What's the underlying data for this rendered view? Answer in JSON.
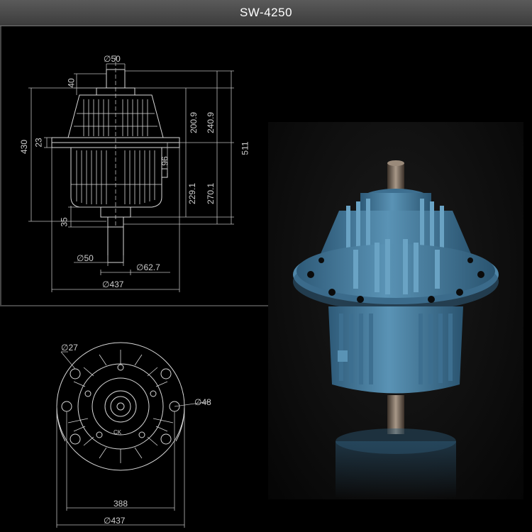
{
  "header": {
    "model": "SW-4250"
  },
  "side_view": {
    "top_shaft_dia": "50",
    "top_shaft_len": "40",
    "flange_thk": "23",
    "height_430": "430",
    "dim_200_9": "200.9",
    "dim_240_9": "240.9",
    "dim_511": "511",
    "dim_96": "96",
    "dim_229_1": "229.1",
    "dim_270_1": "270.1",
    "bottom_35": "35",
    "bottom_shaft_dia": "50",
    "hub_dia": "62.7",
    "overall_dia": "437",
    "dia_symbol": "∅"
  },
  "top_view": {
    "bolt_hole_dia": "27",
    "center_bore_dia": "48",
    "bolt_circle": "388",
    "overall_dia": "437",
    "logo_text": "CK"
  },
  "colors": {
    "line": "#d8d8d8",
    "body": "#4f86a8",
    "body_dark": "#2e5a78",
    "shaft": "#8a7a6a"
  }
}
